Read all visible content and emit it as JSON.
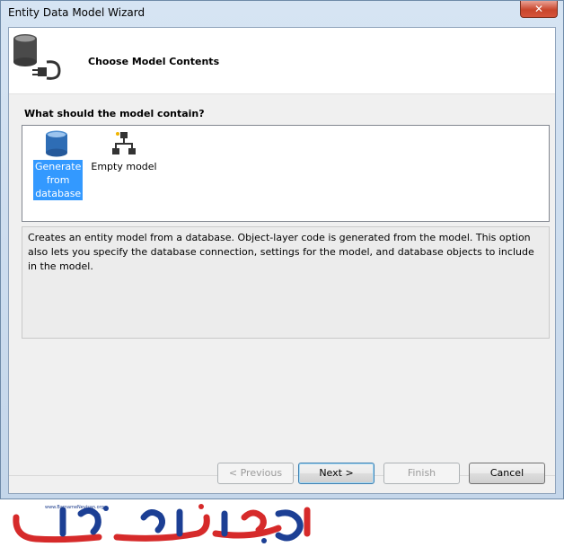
{
  "window": {
    "title": "Entity Data Model Wizard",
    "close_glyph": "✕"
  },
  "header": {
    "title": "Choose Model Contents",
    "icon": "database-plug-icon"
  },
  "question": "What should the model contain?",
  "options": [
    {
      "label": "Generate from database",
      "icon": "database-icon",
      "selected": true
    },
    {
      "label": "Empty model",
      "icon": "hierarchy-icon",
      "selected": false
    }
  ],
  "description": "Creates an entity model from a database. Object-layer code is generated from the model. This option also lets you specify the database connection, settings for the model, and database objects to include in the model.",
  "buttons": {
    "previous": "< Previous",
    "next": "Next >",
    "finish": "Finish",
    "cancel": "Cancel"
  },
  "watermark": {
    "url": "www.BarnameNevisan.org",
    "colors": {
      "red": "#d62a2a",
      "blue": "#1c3f94"
    }
  },
  "colors": {
    "selection": "#3399ff",
    "close_button": "#c9462c"
  }
}
